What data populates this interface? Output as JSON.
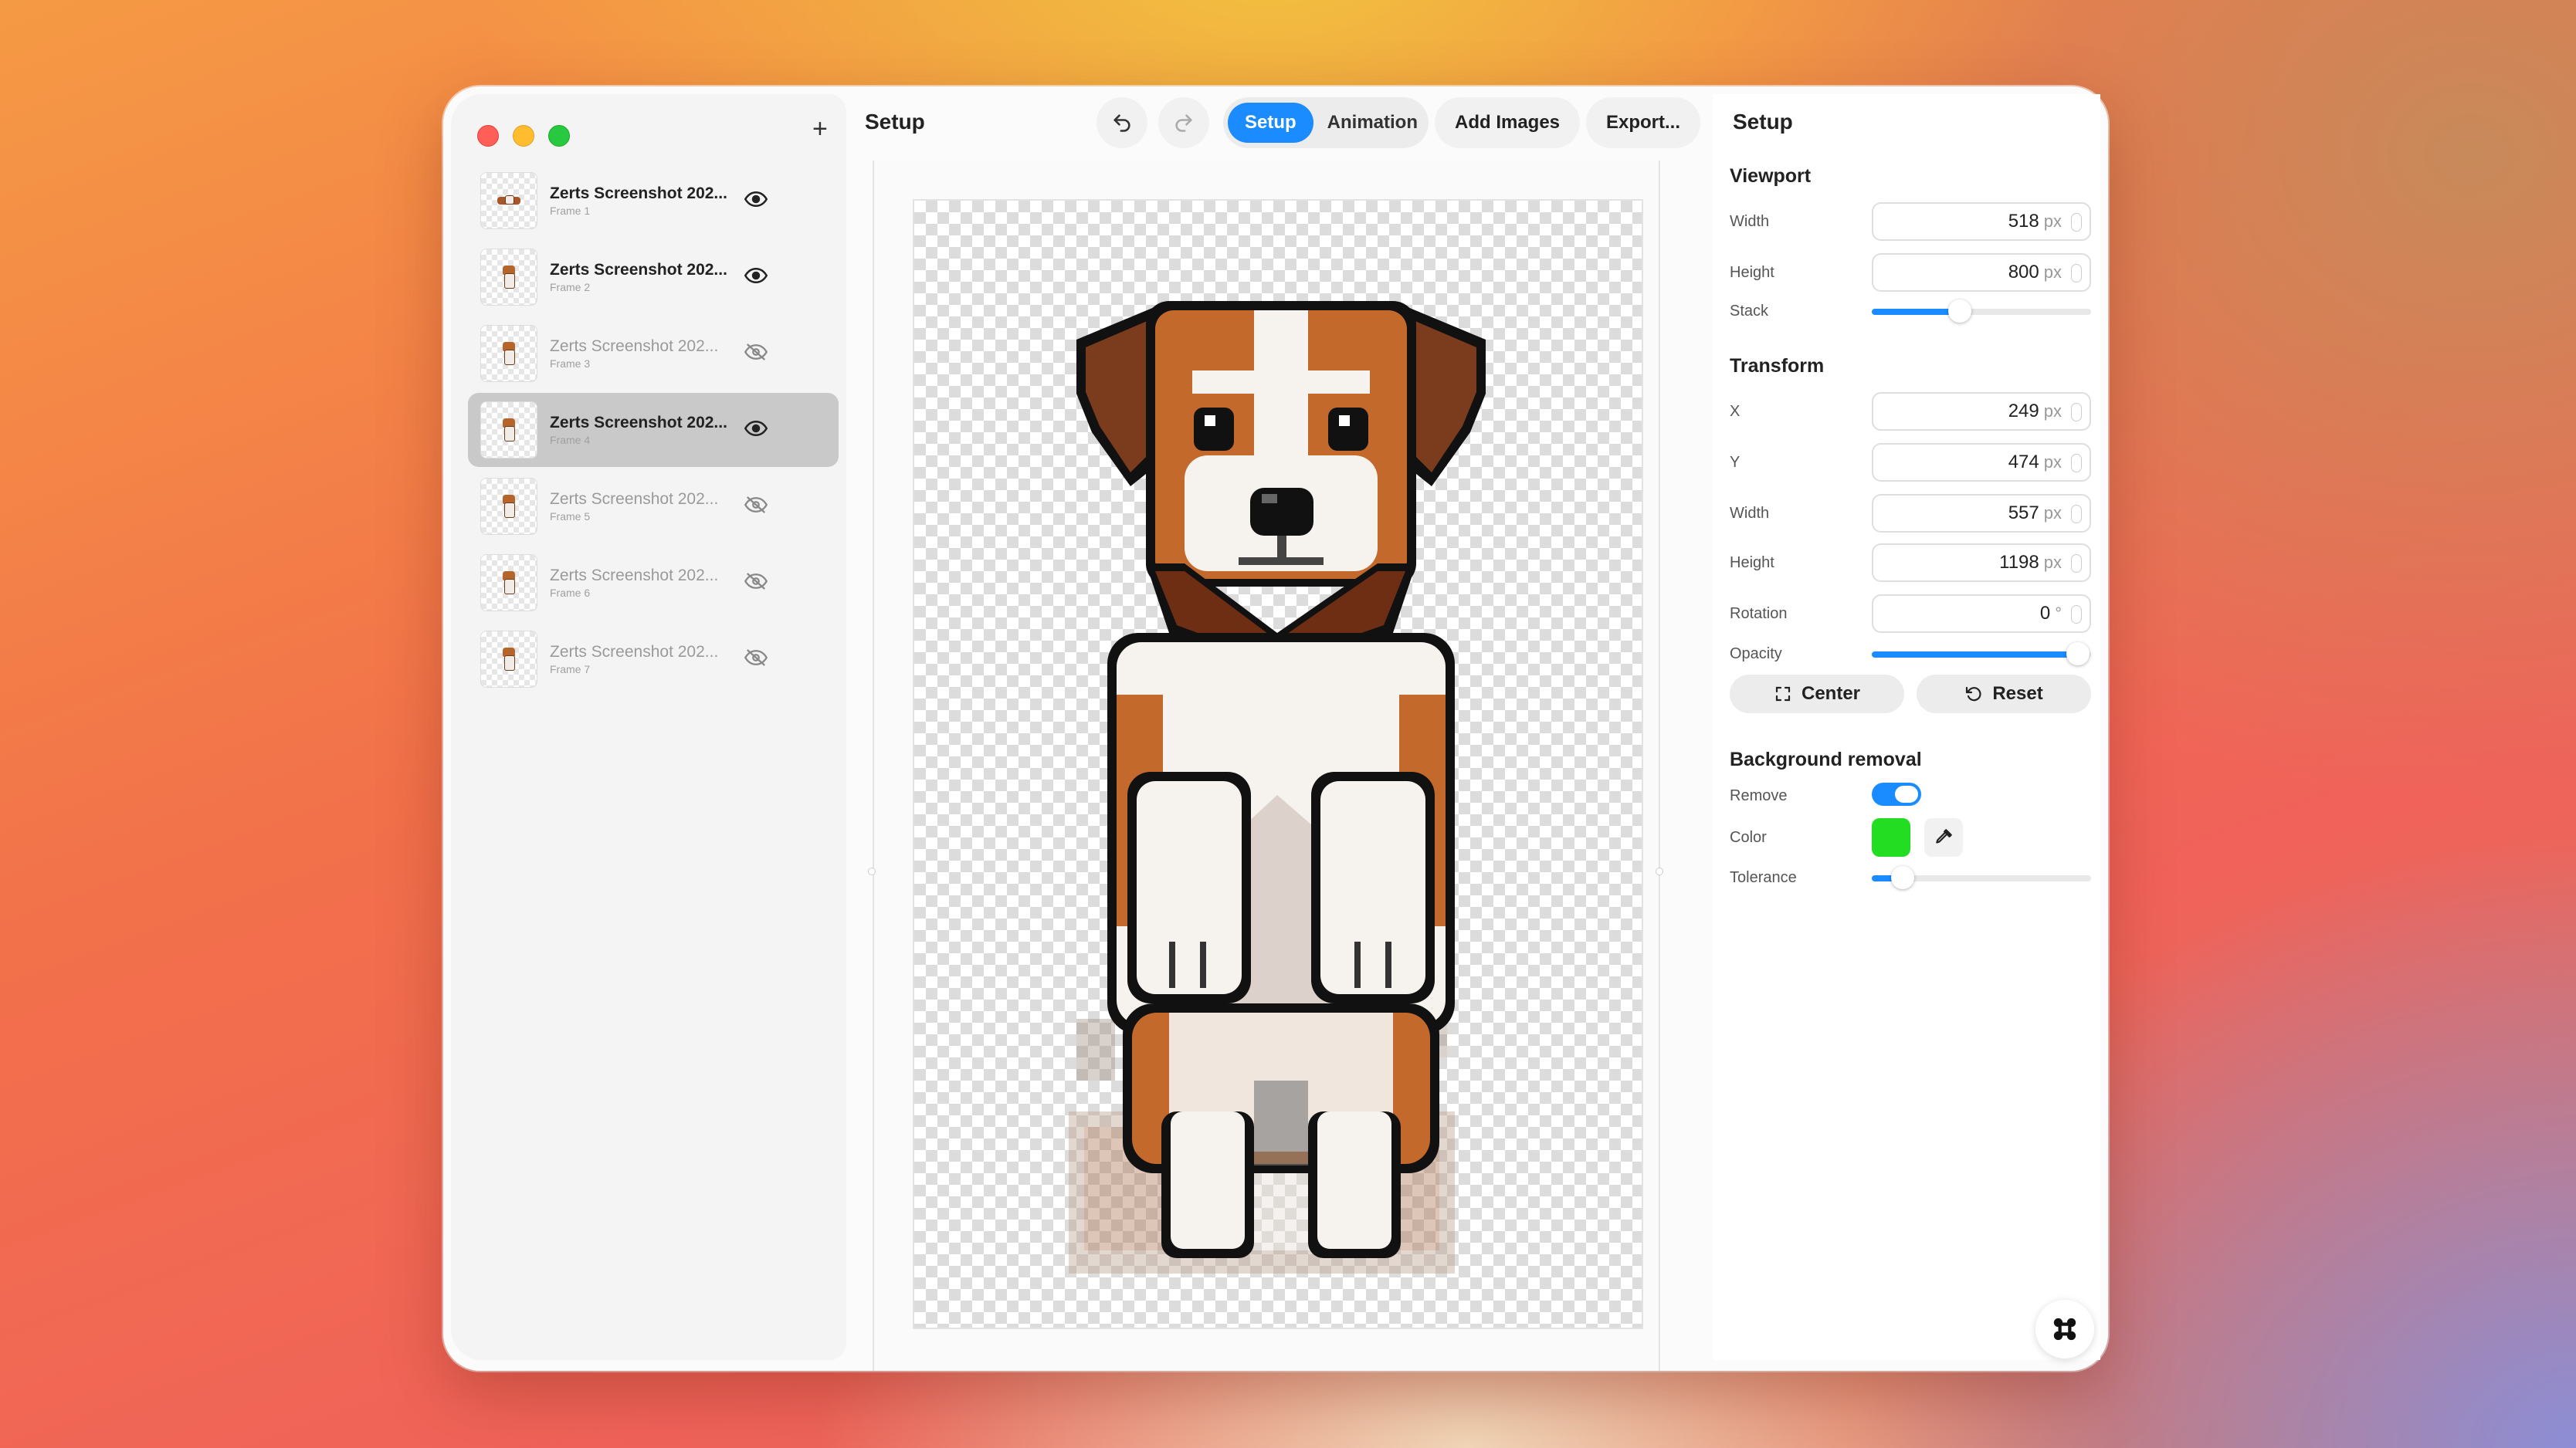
{
  "sidebar": {
    "add_label": "+",
    "frames": [
      {
        "name": "Zerts Screenshot 202...",
        "sub": "Frame 1",
        "visible": true,
        "selected": false,
        "pose": "lying"
      },
      {
        "name": "Zerts Screenshot 202...",
        "sub": "Frame 2",
        "visible": true,
        "selected": false,
        "pose": "sitting"
      },
      {
        "name": "Zerts Screenshot 202...",
        "sub": "Frame 3",
        "visible": false,
        "selected": false,
        "pose": "sitting"
      },
      {
        "name": "Zerts Screenshot 202...",
        "sub": "Frame 4",
        "visible": true,
        "selected": true,
        "pose": "sitting"
      },
      {
        "name": "Zerts Screenshot 202...",
        "sub": "Frame 5",
        "visible": false,
        "selected": false,
        "pose": "sitting"
      },
      {
        "name": "Zerts Screenshot 202...",
        "sub": "Frame 6",
        "visible": false,
        "selected": false,
        "pose": "sitting"
      },
      {
        "name": "Zerts Screenshot 202...",
        "sub": "Frame 7",
        "visible": false,
        "selected": false,
        "pose": "sitting"
      }
    ]
  },
  "toolbar": {
    "title": "Setup",
    "undo_icon": "undo-icon",
    "redo_icon": "redo-icon",
    "tab_setup": "Setup",
    "tab_animation": "Animation",
    "add_images": "Add Images",
    "export": "Export..."
  },
  "panel": {
    "title": "Setup",
    "viewport": {
      "heading": "Viewport",
      "width_label": "Width",
      "width_value": "518",
      "width_unit": "px",
      "height_label": "Height",
      "height_value": "800",
      "height_unit": "px",
      "stack_label": "Stack",
      "stack_level": 0.4
    },
    "transform": {
      "heading": "Transform",
      "x_label": "X",
      "x_value": "249",
      "x_unit": "px",
      "y_label": "Y",
      "y_value": "474",
      "y_unit": "px",
      "width_label": "Width",
      "width_value": "557",
      "width_unit": "px",
      "height_label": "Height",
      "height_value": "1198",
      "height_unit": "px",
      "rotation_label": "Rotation",
      "rotation_value": "0",
      "rotation_unit": "°",
      "opacity_label": "Opacity",
      "opacity_level": 0.94,
      "center_label": "Center",
      "reset_label": "Reset"
    },
    "bg_removal": {
      "heading": "Background removal",
      "remove_label": "Remove",
      "remove_on": true,
      "color_label": "Color",
      "color_value": "#22dd22",
      "tolerance_label": "Tolerance",
      "tolerance_level": 0.14
    }
  },
  "colors": {
    "accent": "#1a8cff",
    "dog_brown": "#b5652a",
    "dog_dark": "#6e3a1c",
    "dog_white": "#f6f2ee",
    "outline": "#111111"
  }
}
